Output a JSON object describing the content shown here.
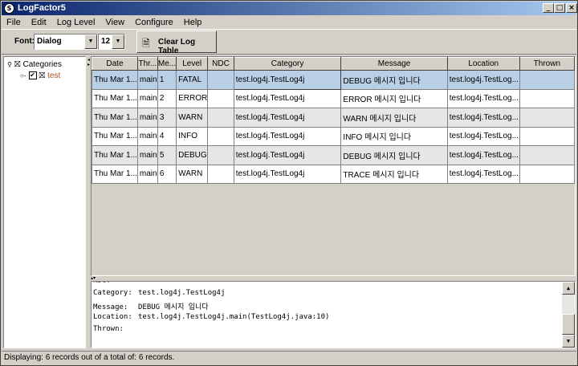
{
  "window": {
    "title": "LogFactor5",
    "icon_glyph": "S",
    "controls": {
      "minimize": "_",
      "maximize": "□",
      "close": "×"
    }
  },
  "menubar": {
    "items": [
      "File",
      "Edit",
      "Log Level",
      "View",
      "Configure",
      "Help"
    ]
  },
  "toolbar": {
    "font_label": "Font:",
    "font_value": "Dialog",
    "size_value": "12",
    "clear_label": "Clear Log Table"
  },
  "tree": {
    "root_label": "Categories",
    "child_label": "test",
    "child_checked": true
  },
  "table": {
    "columns": [
      "Date",
      "Thr...",
      "Me...",
      "Level",
      "NDC",
      "Category",
      "Message",
      "Location",
      "Thrown"
    ],
    "rows": [
      [
        "Thu Mar 1...",
        "main",
        "1",
        "FATAL",
        "",
        "test.log4j.TestLog4j",
        "DEBUG 메시지 입니다",
        "test.log4j.TestLog...",
        ""
      ],
      [
        "Thu Mar 1...",
        "main",
        "2",
        "ERROR",
        "",
        "test.log4j.TestLog4j",
        "ERROR 메시지 입니다",
        "test.log4j.TestLog...",
        ""
      ],
      [
        "Thu Mar 1...",
        "main",
        "3",
        "WARN",
        "",
        "test.log4j.TestLog4j",
        "WARN 메시지 입니다",
        "test.log4j.TestLog...",
        ""
      ],
      [
        "Thu Mar 1...",
        "main",
        "4",
        "INFO",
        "",
        "test.log4j.TestLog4j",
        "INFO 메시지 입니다",
        "test.log4j.TestLog...",
        ""
      ],
      [
        "Thu Mar 1...",
        "main",
        "5",
        "DEBUG",
        "",
        "test.log4j.TestLog4j",
        "DEBUG 메시지 입니다",
        "test.log4j.TestLog...",
        ""
      ],
      [
        "Thu Mar 1...",
        "main",
        "6",
        "WARN",
        "",
        "test.log4j.TestLog4j",
        "TRACE 메시지 입니다",
        "test.log4j.TestLog...",
        ""
      ]
    ],
    "selected_row": 0
  },
  "details": {
    "partial_top": "NDC:",
    "lines": [
      {
        "label": "Category:",
        "value": "test.log4j.TestLog4j"
      },
      {
        "label": "Message:",
        "value": "DEBUG 메시지 입니다"
      },
      {
        "label": "Location:",
        "value": "test.log4j.TestLog4j.main(TestLog4j.java:10)"
      },
      {
        "label": "Thrown:",
        "value": ""
      }
    ]
  },
  "statusbar": {
    "text": "Displaying: 6 records out of a total of: 6 records."
  }
}
